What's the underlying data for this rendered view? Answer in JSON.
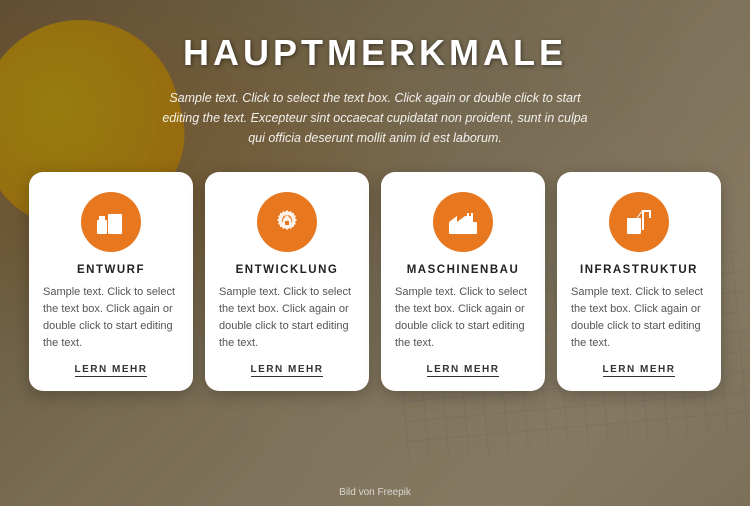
{
  "background": {
    "photo_credit": "Bild von Freepik"
  },
  "header": {
    "title": "HAUPTMERKMALE",
    "subtitle": "Sample text. Click to select the text box. Click again or double click to start editing the text. Excepteur sint occaecat cupidatat non proident, sunt in culpa qui officia deserunt mollit anim id est laborum."
  },
  "cards": [
    {
      "id": "entwurf",
      "icon": "building-icon",
      "title": "ENTWURF",
      "text": "Sample text. Click to select the text box. Click again or double click to start editing the text.",
      "link": "LERN MEHR"
    },
    {
      "id": "entwicklung",
      "icon": "gear-building-icon",
      "title": "ENTWICKLUNG",
      "text": "Sample text. Click to select the text box. Click again or double click to start editing the text.",
      "link": "LERN MEHR"
    },
    {
      "id": "maschinenbau",
      "icon": "factory-icon",
      "title": "MASCHINENBAU",
      "text": "Sample text. Click to select the text box. Click again or double click to start editing the text.",
      "link": "LERN MEHR"
    },
    {
      "id": "infrastruktur",
      "icon": "crane-building-icon",
      "title": "INFRASTRUKTUR",
      "text": "Sample text. Click to select the text box. Click again or double click to start editing the text.",
      "link": "LERN MEHR"
    }
  ]
}
